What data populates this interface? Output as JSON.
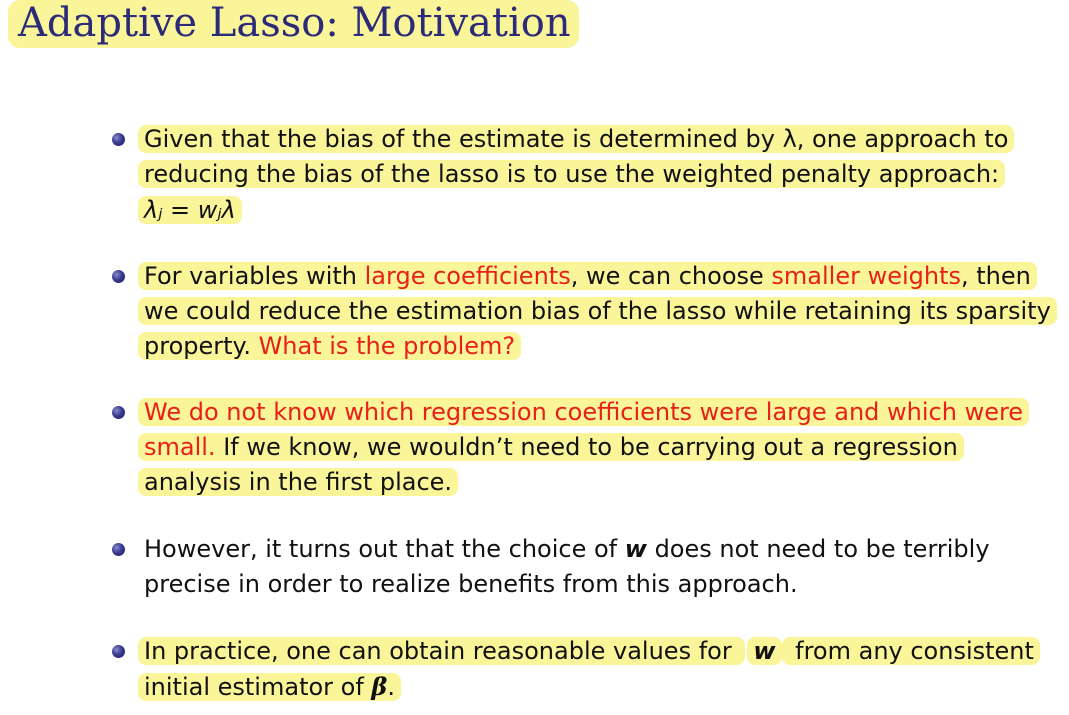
{
  "slide": {
    "title": "Adaptive Lasso: Motivation"
  },
  "bullets": {
    "b1": {
      "line1": "Given that the bias of the estimate is determined by λ, one approach to",
      "line2": "reducing the bias of the lasso is to use the weighted penalty approach:",
      "formula": "λⱼ = wⱼλ"
    },
    "b2": {
      "l1_a": "For variables with ",
      "l1_red1": "large coefficients",
      "l1_b": ", we can choose ",
      "l1_red2": "smaller weights",
      "l1_c": ", then",
      "line2": "we could reduce the estimation bias of the lasso while retaining its sparsity",
      "l3_a": "property. ",
      "l3_red": "What is the problem?"
    },
    "b3": {
      "line1_red": "We do not know which regression coefficients were large and which were",
      "l2_red": "small.",
      "l2_rest": " If we know, we wouldn’t need to be carrying out a regression",
      "line3": "analysis in the first place."
    },
    "b4": {
      "l1_a": "However, it turns out that the choice of ",
      "l1_w": "w",
      "l1_b": " does not need to be terribly",
      "line2": "precise in order to realize benefits from this approach."
    },
    "b5": {
      "l1_a": "In practice, one can obtain reasonable values for ",
      "l1_w": "w",
      "l1_b": " from any consistent",
      "l2_a": "initial estimator of ",
      "l2_beta": "β",
      "l2_b": "."
    }
  }
}
